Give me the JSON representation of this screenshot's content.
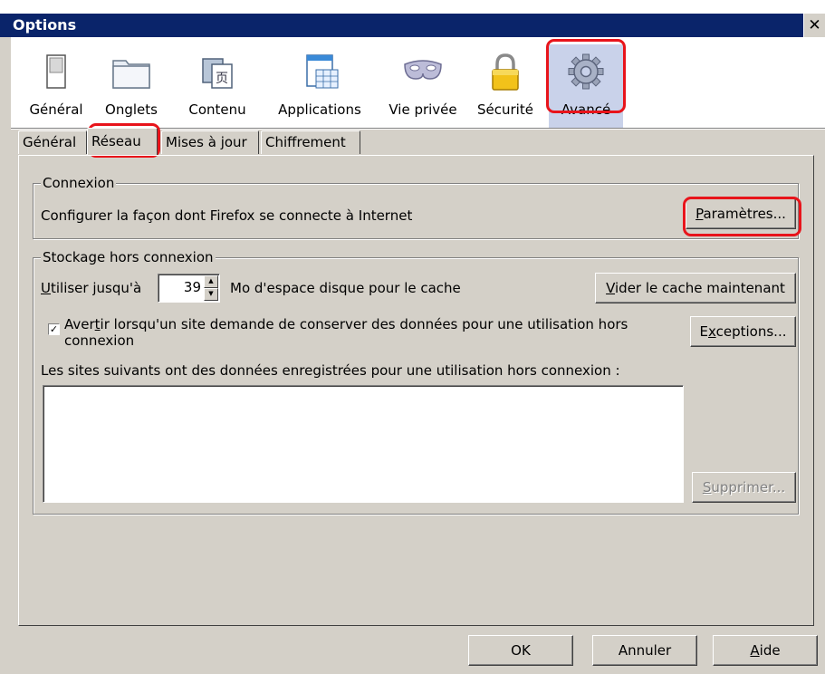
{
  "window": {
    "title": "Options",
    "close_glyph": "✕"
  },
  "toolbar": {
    "items": [
      {
        "label": "Général",
        "icon": "general-icon"
      },
      {
        "label": "Onglets",
        "icon": "tabs-icon"
      },
      {
        "label": "Contenu",
        "icon": "content-icon"
      },
      {
        "label": "Applications",
        "icon": "applications-icon"
      },
      {
        "label": "Vie privée",
        "icon": "privacy-mask-icon"
      },
      {
        "label": "Sécurité",
        "icon": "padlock-icon"
      },
      {
        "label": "Avancé",
        "icon": "gear-icon",
        "selected": true
      }
    ]
  },
  "tabs": [
    {
      "label": "Général"
    },
    {
      "label": "Réseau",
      "active": true
    },
    {
      "label": "Mises à jour"
    },
    {
      "label": "Chiffrement"
    }
  ],
  "connexion": {
    "title": "Connexion",
    "description": "Configurer la façon dont Firefox se connecte à Internet",
    "settings_button": {
      "mnemonic": "P",
      "rest": "aramètres..."
    }
  },
  "storage": {
    "title": "Stockage hors connexion",
    "use_up_to": {
      "mnemonic": "U",
      "rest": "tiliser jusqu'à"
    },
    "cache_value": "39",
    "cache_unit": "Mo d'espace disque pour le cache",
    "clear_cache_button": {
      "mnemonic": "V",
      "rest": "ider le cache maintenant"
    },
    "warn_checkbox": {
      "checked": true,
      "label_pre": "Aver",
      "mnemonic": "t",
      "label_line1_rest": "ir lorsqu'un site demande de conserver des données pour une utilisation hors",
      "label_line2": "connexion"
    },
    "exceptions_button": {
      "pre": "E",
      "mnemonic": "x",
      "rest": "ceptions..."
    },
    "sites_label": "Les sites suivants ont des données enregistrées pour une utilisation hors connexion :",
    "sites_list": [],
    "delete_button": {
      "mnemonic": "S",
      "rest": "upprimer..."
    }
  },
  "footer": {
    "ok": "OK",
    "cancel": "Annuler",
    "help": {
      "mnemonic": "A",
      "rest": "ide"
    }
  },
  "colors": {
    "title_bar": "#0a246a",
    "dialog_bg": "#d4d0c8",
    "selected_toolbar_bg": "#c9d2ea",
    "highlight_red": "#e8141b"
  }
}
